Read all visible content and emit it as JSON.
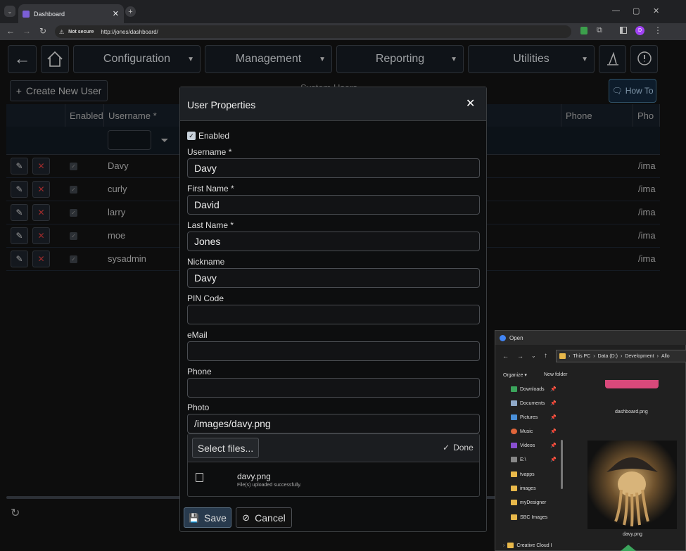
{
  "browser": {
    "tab_title": "Dashboard",
    "not_secure": "Not secure",
    "url": "http://jones/dashboard/",
    "profile": "D"
  },
  "nav": {
    "items": [
      "Configuration",
      "Management",
      "Reporting",
      "Utilities"
    ]
  },
  "page": {
    "create_button": "Create New User",
    "title_fragment": "System Users",
    "how_to": "How To"
  },
  "grid": {
    "headers": [
      "Enabled",
      "Username *",
      "Phone",
      "Pho"
    ],
    "rows": [
      {
        "username": "Davy",
        "photo": "/ima"
      },
      {
        "username": "curly",
        "photo": "/ima"
      },
      {
        "username": "larry",
        "photo": "/ima"
      },
      {
        "username": "moe",
        "photo": "/ima"
      },
      {
        "username": "sysadmin",
        "photo": "/ima"
      }
    ]
  },
  "modal": {
    "title": "User Properties",
    "enabled_label": "Enabled",
    "fields": {
      "username": {
        "label": "Username *",
        "value": "Davy"
      },
      "first_name": {
        "label": "First Name *",
        "value": "David"
      },
      "last_name": {
        "label": "Last Name *",
        "value": "Jones"
      },
      "nickname": {
        "label": "Nickname",
        "value": "Davy"
      },
      "pin": {
        "label": "PIN Code",
        "value": ""
      },
      "email": {
        "label": "eMail",
        "value": ""
      },
      "phone": {
        "label": "Phone",
        "value": ""
      },
      "photo": {
        "label": "Photo",
        "value": "/images/davy.png"
      }
    },
    "upload": {
      "select_files": "Select files...",
      "done": "Done",
      "file_name": "davy.png",
      "file_status": "File(s) uploaded successfully."
    },
    "save": "Save",
    "cancel": "Cancel"
  },
  "file_dialog": {
    "title": "Open",
    "path": [
      "This PC",
      "Data (D:)",
      "Development",
      "Allo"
    ],
    "organize": "Organize",
    "new_folder": "New folder",
    "nav_items": [
      "Downloads",
      "Documents",
      "Pictures",
      "Music",
      "Videos",
      "E:\\",
      "tvapps",
      "images",
      "myDesigner",
      "SBC Images",
      "Creative Cloud I"
    ],
    "files": [
      "dashboard.png",
      "davy.png"
    ]
  }
}
